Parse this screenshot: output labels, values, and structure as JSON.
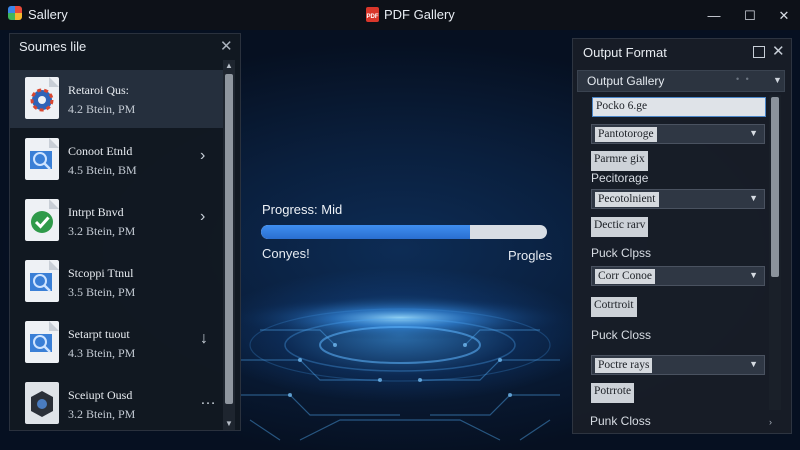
{
  "app": {
    "name": "Sallery",
    "document_title": "PDF Gallery"
  },
  "window_controls": {
    "minimize": "—",
    "maximize": "☐",
    "close": "✕"
  },
  "sources": {
    "title": "Soumes  lile",
    "items": [
      {
        "name": "Retaroi Qus:",
        "meta": "4.2 Btein, PM",
        "icon": "gear-document-icon",
        "arrow": ""
      },
      {
        "name": "Conoot Etnld",
        "meta": "4.5 Btein, BM",
        "icon": "search-document-icon",
        "arrow": "›"
      },
      {
        "name": "Intrpt Bnvd",
        "meta": "3.2 Btein, PM",
        "icon": "check-document-icon",
        "arrow": "›"
      },
      {
        "name": "Stcoppi Ttnul",
        "meta": "3.5 Btein, PM",
        "icon": "search-document-icon",
        "arrow": ""
      },
      {
        "name": "Setarpt tuout",
        "meta": "4.3 Btein, PM",
        "icon": "search-document-icon",
        "arrow": "↓"
      },
      {
        "name": "Sceiupt Ousd",
        "meta": "3.2 Btein, PM",
        "icon": "gear-document-icon",
        "arrow": "…"
      }
    ]
  },
  "progress": {
    "label": "Progress: Mid",
    "value": 0.73,
    "left_label": "Conyes!",
    "right_label": "Progles"
  },
  "output": {
    "title": "Output Format",
    "gallery_label": "Output Gallery",
    "gallery_dots": "• •",
    "fields": {
      "input1": "Pocko 6.ge",
      "select1": "Pantotoroge",
      "chip1": "Parmre gix",
      "text1": "Pecitorage",
      "select2": "Pecotolnient",
      "chip2": "Dectic rarv",
      "text2": "Puck Clpss",
      "select3": "Corr Conoe",
      "chip3": "Cotrtroit",
      "text3": "Puck Closs",
      "select4": "Poctre rays",
      "chip4": "Potrrote",
      "footer": "Punk Closs"
    }
  }
}
